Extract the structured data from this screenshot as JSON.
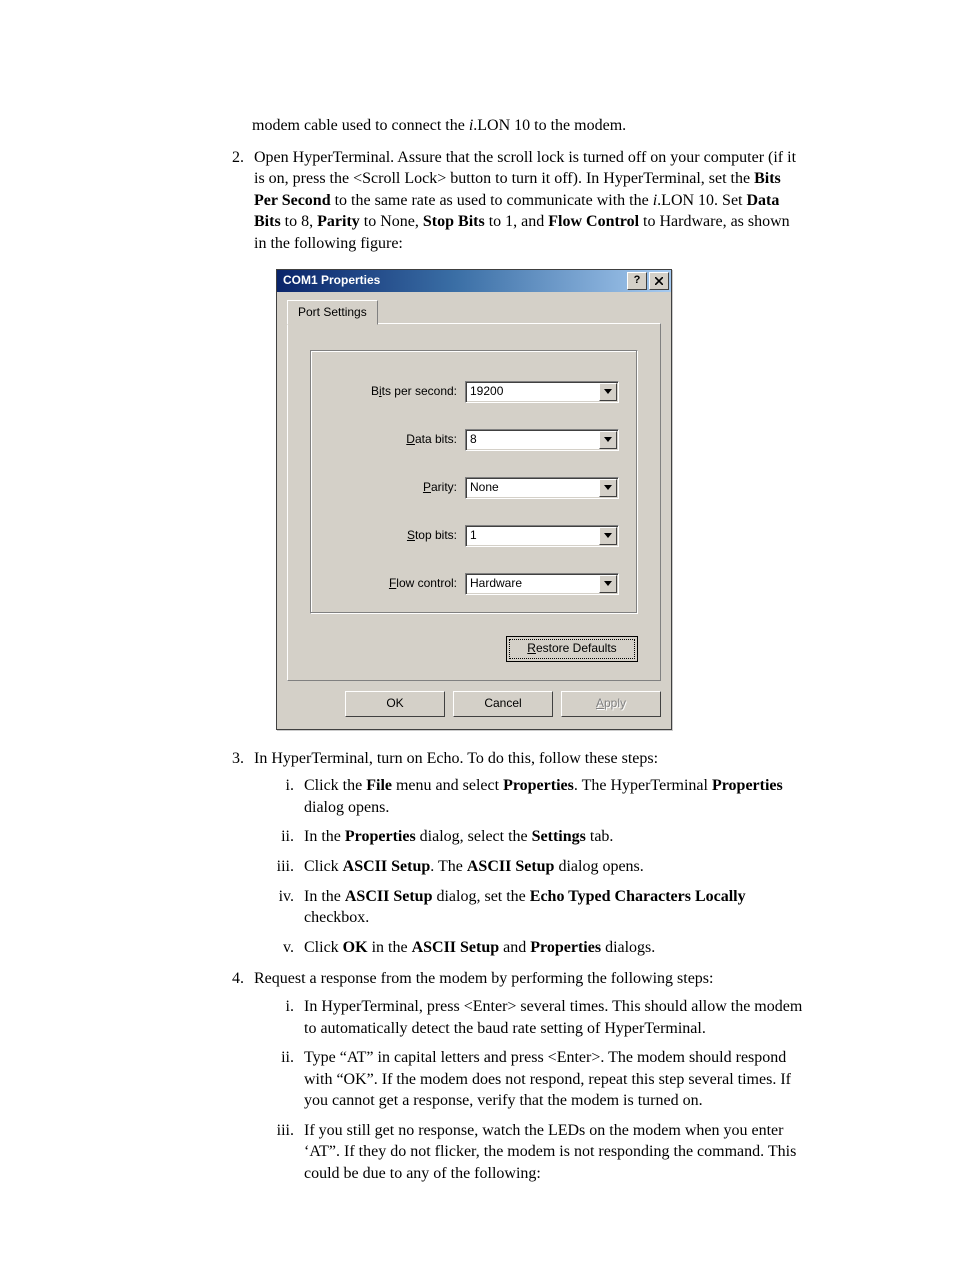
{
  "paragraphs": {
    "orphan_line": "modem cable used to connect the ",
    "orphan_line_after": ".LON 10 to the modem.",
    "italic_i": "i"
  },
  "step2": {
    "p1": "Open HyperTerminal.  Assure that the scroll lock is turned off on your computer (if it is on, press the <Scroll Lock> button to turn it off).  In HyperTerminal, set the ",
    "b1": "Bits Per Second",
    "p2": " to the same rate as used to communicate with the ",
    "i1": "i",
    "p3": ".LON 10.  Set ",
    "b2": "Data Bits",
    "p4": " to 8, ",
    "b3": "Parity",
    "p5": " to None, ",
    "b4": "Stop Bits",
    "p6": " to 1, and ",
    "b5": "Flow Control",
    "p7": " to Hardware, as shown in the following figure:"
  },
  "dialog": {
    "title": "COM1 Properties",
    "tab": "Port Settings",
    "fields": {
      "bits_per_second": {
        "label_pre": "B",
        "label_ul": "i",
        "label_post": "ts per second:",
        "value": "19200"
      },
      "data_bits": {
        "label_pre": "",
        "label_ul": "D",
        "label_post": "ata bits:",
        "value": "8"
      },
      "parity": {
        "label_pre": "",
        "label_ul": "P",
        "label_post": "arity:",
        "value": "None"
      },
      "stop_bits": {
        "label_pre": "",
        "label_ul": "S",
        "label_post": "top bits:",
        "value": "1"
      },
      "flow_control": {
        "label_pre": "",
        "label_ul": "F",
        "label_post": "low control:",
        "value": "Hardware"
      }
    },
    "restore_pre": "",
    "restore_ul": "R",
    "restore_post": "estore Defaults",
    "ok": "OK",
    "cancel": "Cancel",
    "apply_pre": "",
    "apply_ul": "A",
    "apply_post": "pply"
  },
  "step3": {
    "intro": "In HyperTerminal, turn on Echo.  To do this, follow these steps:",
    "i": {
      "p1": "Click the ",
      "b1": "File",
      "p2": " menu and select ",
      "b2": "Properties",
      "p3": ".  The HyperTerminal ",
      "b3": "Properties",
      "p4": " dialog opens."
    },
    "ii": {
      "p1": "In the ",
      "b1": "Properties",
      "p2": " dialog, select the ",
      "b2": "Settings",
      "p3": " tab."
    },
    "iii": {
      "p1": "Click ",
      "b1": "ASCII Setup",
      "p2": ".  The ",
      "b2": "ASCII Setup",
      "p3": " dialog opens."
    },
    "iv": {
      "p1": "In the ",
      "b1": "ASCII Setup",
      "p2": " dialog, set the ",
      "b2": "Echo Typed Characters Locally",
      "p3": " checkbox."
    },
    "v": {
      "p1": "Click ",
      "b1": "OK",
      "p2": " in the ",
      "b2": "ASCII Setup",
      "p3": " and ",
      "b3": "Properties",
      "p4": " dialogs."
    }
  },
  "step4": {
    "intro": "Request a response from the modem by performing the following steps:",
    "i": "In HyperTerminal, press <Enter> several times.  This should allow the modem to automatically detect the baud rate setting of HyperTerminal.",
    "ii": "Type “AT” in capital letters and press <Enter>.  The modem should respond with “OK”.  If the modem does not respond, repeat this step several times.  If you cannot get a response, verify that the modem is turned on.",
    "iii": "If you still get no response, watch the LEDs on the modem when you enter ‘AT”.  If they do not flicker, the modem is not responding the command.  This could be due to any of the following:"
  }
}
